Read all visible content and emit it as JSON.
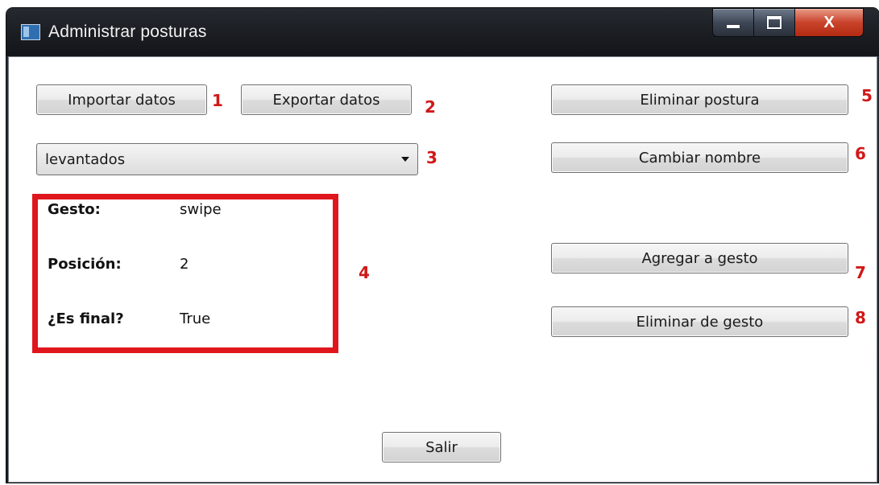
{
  "window": {
    "title": "Administrar posturas",
    "close_glyph": "X"
  },
  "buttons": {
    "import": "Importar datos",
    "export": "Exportar datos",
    "delete_posture": "Eliminar postura",
    "rename": "Cambiar nombre",
    "add_to_gesture": "Agregar a gesto",
    "remove_from_gesture": "Eliminar de gesto",
    "exit": "Salir"
  },
  "combo": {
    "selected": "levantados"
  },
  "info": {
    "gesture_label": "Gesto:",
    "gesture_value": "swipe",
    "position_label": "Posición:",
    "position_value": "2",
    "final_label": "¿Es final?",
    "final_value": "True"
  },
  "annotations": [
    "1",
    "2",
    "3",
    "4",
    "5",
    "6",
    "7",
    "8"
  ],
  "colors": {
    "annotation": "#d01818",
    "highlight_box": "#e0161d",
    "close_button": "#c9432b"
  }
}
